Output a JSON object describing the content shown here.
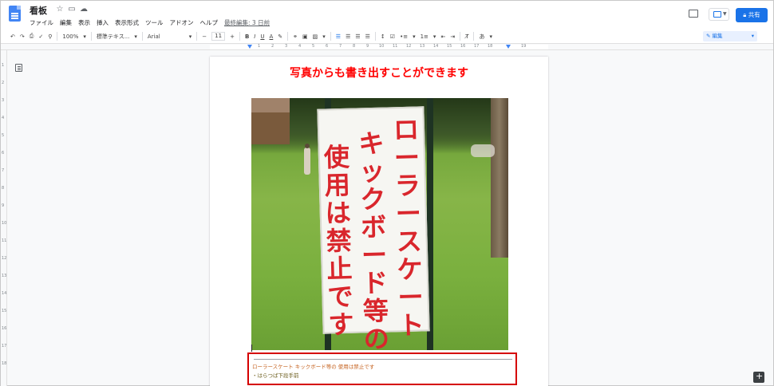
{
  "app": {
    "doc_title": "看板",
    "menu": [
      "ファイル",
      "編集",
      "表示",
      "挿入",
      "表示形式",
      "ツール",
      "アドオン",
      "ヘルプ"
    ],
    "last_edit": "最終編集: 3 日前",
    "share_label": "共有",
    "edit_mode_label": "編集"
  },
  "toolbar": {
    "zoom": "100%",
    "style": "標準テキス...",
    "font": "Arial",
    "font_size": "11",
    "minus": "−",
    "plus": "+",
    "bold": "B",
    "italic": "I",
    "underline": "U",
    "text_color": "A",
    "input_tool": "あ"
  },
  "ruler": {
    "numbers": [
      "1",
      "2",
      "3",
      "4",
      "5",
      "6",
      "7",
      "8",
      "9",
      "10",
      "11",
      "12",
      "13",
      "14",
      "15",
      "16",
      "17",
      "18",
      "19"
    ],
    "vnumbers": [
      "1",
      "2",
      "3",
      "4",
      "5",
      "6",
      "7",
      "8",
      "9",
      "10",
      "11",
      "12",
      "13",
      "14",
      "15",
      "16",
      "17",
      "18"
    ]
  },
  "document": {
    "heading": "写真からも書き出すことができます",
    "heading_color": "#ff0000",
    "photo": {
      "sign_columns": [
        "ローラースケート",
        "キックボード等の",
        "使用は禁止です"
      ],
      "sign_text_color": "#d9262c"
    },
    "extracted_line_1": "ローラースケート キックボード等の 使用は禁止です",
    "extracted_line_2": "・はらつば下段手前"
  },
  "highlight_color": "#d50000",
  "accent_color": "#1a73e8"
}
